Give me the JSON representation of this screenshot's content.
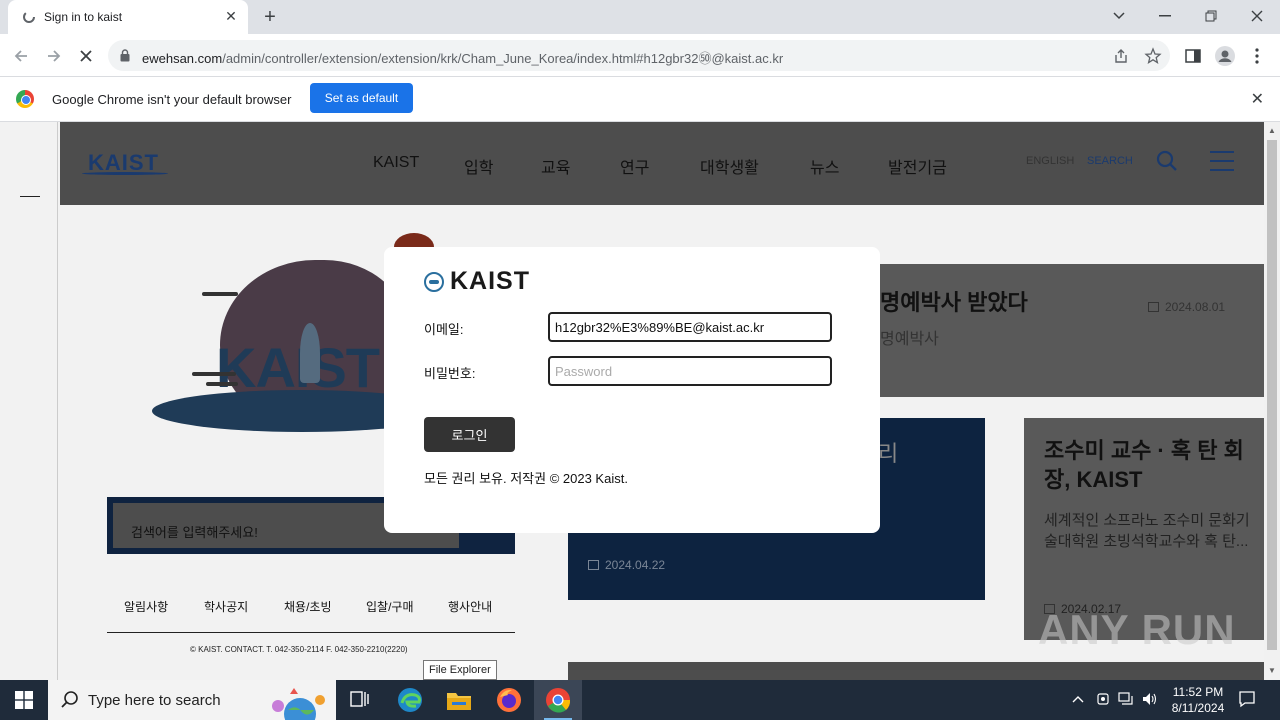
{
  "browser": {
    "tab_title": "Sign in to kaist",
    "url_host": "ewehsan.com",
    "url_path": "/admin/controller/extension/extension/krk/Cham_June_Korea/index.html#h12gbr32㊿@kaist.ac.kr",
    "infobar_message": "Google Chrome isn't your default browser",
    "infobar_button": "Set as default"
  },
  "site": {
    "logo": "KAIST",
    "nav": [
      "KAIST",
      "입학",
      "교육",
      "연구",
      "대학생활",
      "뉴스",
      "발전기금"
    ],
    "lang_english": "ENGLISH",
    "lang_search": "SEARCH",
    "hero_logo": "KAIST",
    "search_placeholder": "검색어를 입력해주세요!",
    "quick_links": [
      "알림사항",
      "학사공지",
      "채용/초빙",
      "입찰/구매",
      "행사안내"
    ],
    "footer": "© KAIST. CONTACT. T. 042-350-2114 F. 042-350-2210(2220)",
    "news_title": "명예박사 받았다",
    "news_sub": "명예박사",
    "news_date": "2024.08.01",
    "navy_card_title": "리",
    "navy_card_date": "2024.04.22",
    "grey_card_title": "조수미 교수 · 혹 탄 회장, KAIST",
    "grey_card_body": "세계적인 소프라노 조수미 문화기술대학원 초빙석학교수와 혹 탄...",
    "grey_card_date": "2024.02.17"
  },
  "modal": {
    "brand": "KAIST",
    "email_label": "이메일:",
    "email_value": "h12gbr32%E3%89%BE@kaist.ac.kr",
    "password_label": "비밀번호:",
    "password_placeholder": "Password",
    "login_button": "로그인",
    "copyright": "모든 권리 보유. 저작권 © 2023 Kaist."
  },
  "tooltip": "File Explorer",
  "watermark": "ANY RUN",
  "taskbar": {
    "search_placeholder": "Type here to search",
    "time": "11:52 PM",
    "date": "8/11/2024"
  },
  "colors": {
    "chrome_blue": "#1a73e8",
    "kaist_navy": "#0d2340",
    "header_grey": "#4d4d4d",
    "taskbar": "#1f2b3a"
  }
}
